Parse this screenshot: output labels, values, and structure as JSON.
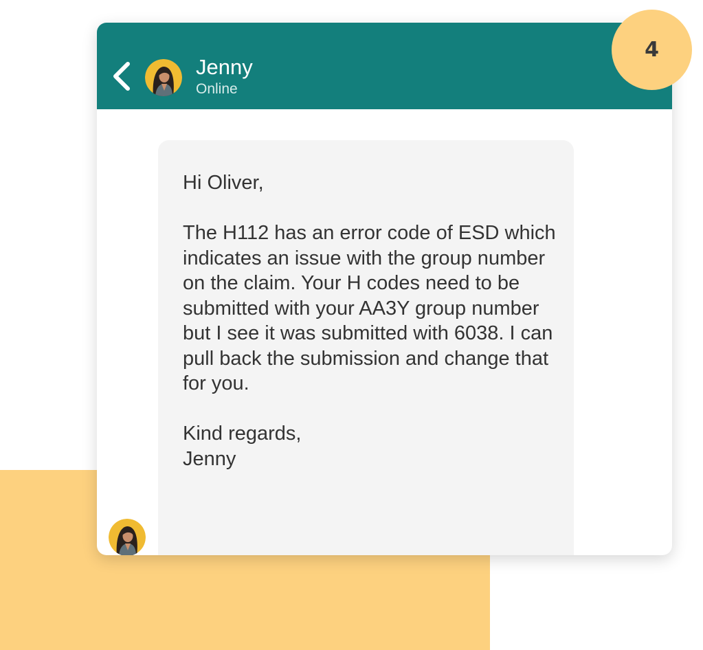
{
  "step": {
    "number": "4"
  },
  "header": {
    "back_icon": "chevron-left-icon",
    "contact_name": "Jenny",
    "status": "Online"
  },
  "message": {
    "greeting": "Hi Oliver,",
    "body": "The H112 has an error code of ESD which indicates an issue with the group number on the claim. Your H codes need to be submitted with your AA3Y group number but I see it was submitted with 6038. I can pull back the submission and change that for you.",
    "signoff_line1": "Kind regards,",
    "signoff_line2": "Jenny"
  },
  "colors": {
    "header_bg": "#137f7c",
    "accent_yellow": "#fdd17f",
    "bubble_bg": "#f4f4f4",
    "text": "#333333"
  }
}
